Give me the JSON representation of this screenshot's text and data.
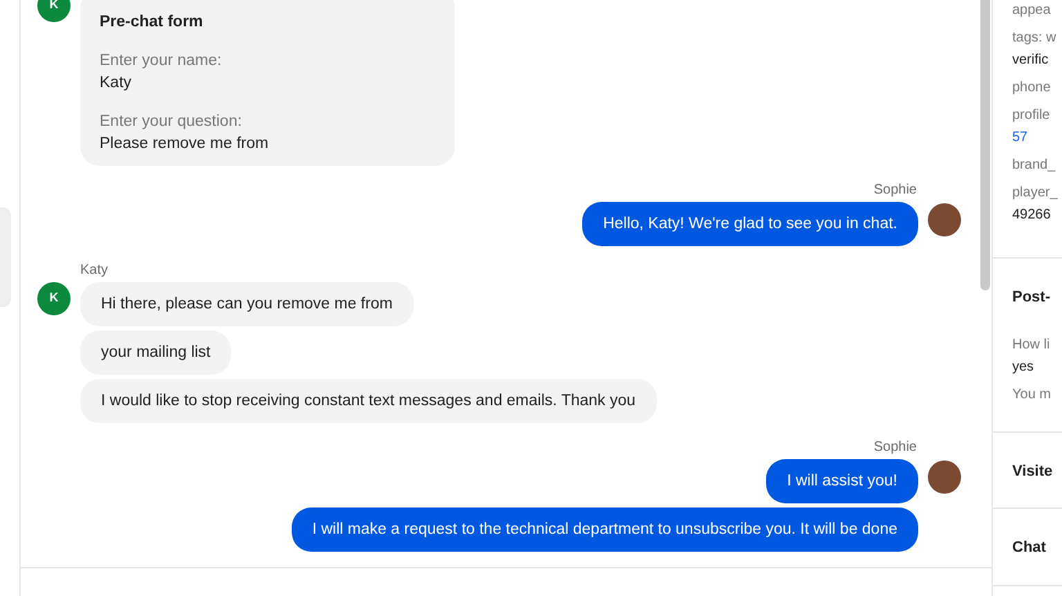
{
  "chat": {
    "groups": [
      {
        "kind": "incoming",
        "avatar_letter": "K",
        "bubbles": [
          {
            "kind": "form",
            "title": "Pre-chat form",
            "fields": [
              {
                "label": "Enter your name:",
                "value": "Katy"
              },
              {
                "label": "Enter your question:",
                "value": "Please remove me from"
              }
            ]
          }
        ]
      },
      {
        "kind": "outgoing",
        "sender": "Sophie",
        "bubbles": [
          {
            "kind": "text",
            "text": "Hello, Katy! We're glad to see you in chat."
          }
        ]
      },
      {
        "kind": "incoming",
        "sender": "Katy",
        "avatar_letter": "K",
        "bubbles": [
          {
            "kind": "text",
            "text": "Hi there, please can you remove me from"
          },
          {
            "kind": "text",
            "text": "your mailing list"
          },
          {
            "kind": "text",
            "text": "I would like to stop receiving constant text messages and emails. Thank you"
          }
        ]
      },
      {
        "kind": "outgoing",
        "sender": "Sophie",
        "bubbles": [
          {
            "kind": "text",
            "text": "I will assist you!"
          },
          {
            "kind": "text",
            "text": "I will make a request to the technical department to unsubscribe you. It will be done"
          }
        ]
      }
    ]
  },
  "details_panel": {
    "sections": [
      {
        "entries": [
          {
            "label": "appea"
          },
          {
            "label": "tags: w",
            "value": "verific"
          },
          {
            "label": "phone"
          },
          {
            "label": "profile",
            "value": "57",
            "value_is_link": true
          },
          {
            "label": "brand_"
          },
          {
            "label": "player_",
            "value": "49266"
          }
        ]
      },
      {
        "heading": "Post-",
        "entries": [
          {
            "label": "How li",
            "value": "yes"
          },
          {
            "label": "You m"
          }
        ]
      },
      {
        "heading": "Visite"
      },
      {
        "heading": "Chat"
      }
    ]
  }
}
